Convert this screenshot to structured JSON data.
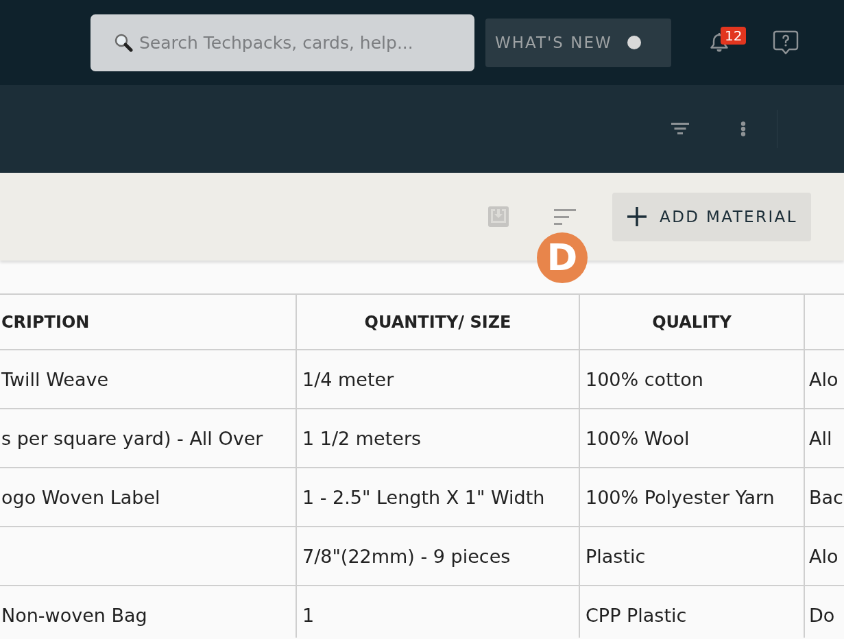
{
  "header": {
    "search": {
      "placeholder": "Search Techpacks, cards, help..."
    },
    "whats_new": {
      "label": "WHAT'S NEW",
      "unread": true
    },
    "notifications": {
      "count": "12"
    }
  },
  "materials_toolbar": {
    "add_button": "ADD MATERIAL"
  },
  "floating_badge": {
    "label": "D"
  },
  "table": {
    "columns": [
      "CRIPTION",
      "QUANTITY/ SIZE",
      "QUALITY",
      null
    ],
    "rows": [
      [
        "Twill Weave",
        "1/4 meter",
        "100% cotton",
        "Alo"
      ],
      [
        "s per square yard) - All Over",
        "1 1/2 meters",
        "100% Wool",
        "All"
      ],
      [
        "ogo Woven Label",
        "1 - 2.5\" Length X 1\" Width",
        "100% Polyester Yarn",
        "Bac"
      ],
      [
        null,
        "7/8\"(22mm) - 9 pieces",
        "Plastic",
        "Alo"
      ],
      [
        "Non-woven Bag",
        "1",
        "CPP Plastic",
        "Do"
      ]
    ]
  }
}
